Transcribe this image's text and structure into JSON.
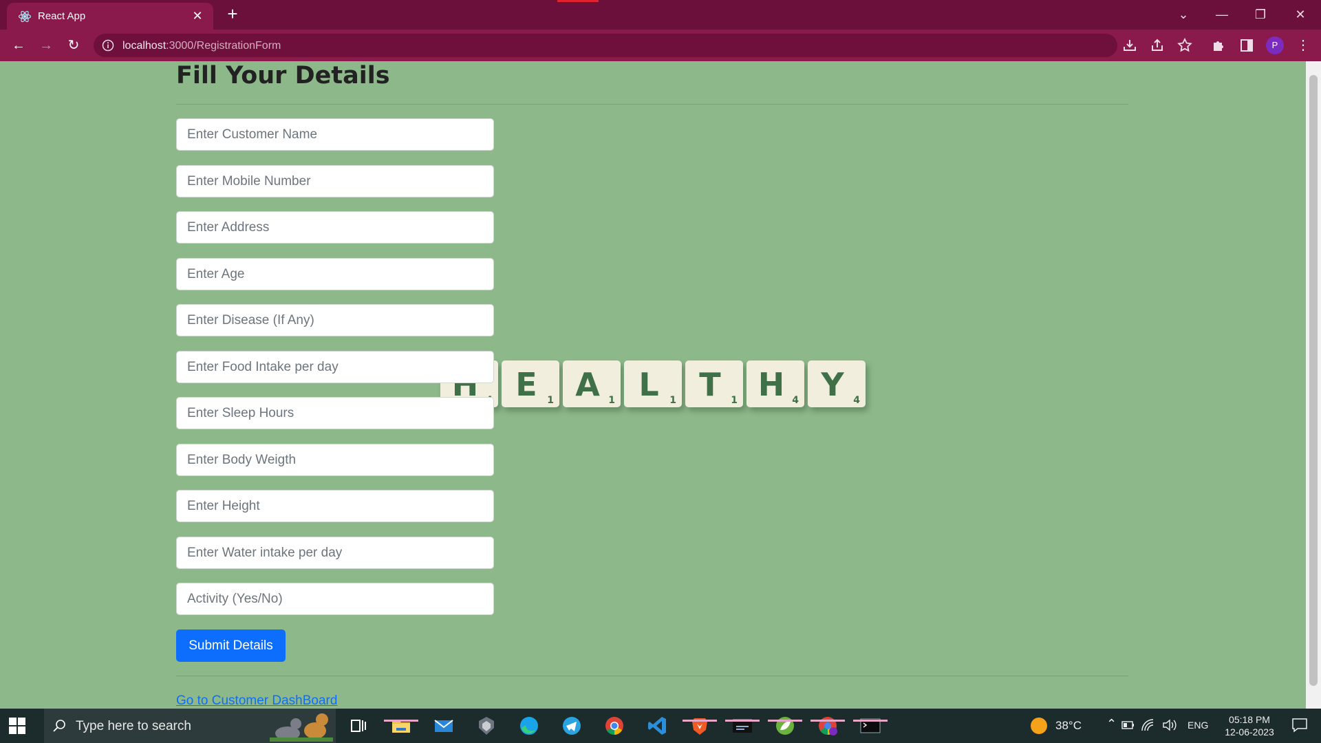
{
  "browser": {
    "tab_title": "React App",
    "url_host": "localhost",
    "url_rest": ":3000/RegistrationForm",
    "profile_initial": "P"
  },
  "page": {
    "heading": "Fill Your Details",
    "fields": {
      "customer_name": "Enter Customer Name",
      "mobile": "Enter Mobile Number",
      "address": "Enter Address",
      "age": "Enter Age",
      "disease": "Enter Disease (If Any)",
      "food": "Enter Food Intake per day",
      "sleep": "Enter Sleep Hours",
      "weight": "Enter Body Weigth",
      "height": "Enter Height",
      "water": "Enter Water intake per day",
      "activity": "Activity (Yes/No)"
    },
    "submit_label": "Submit Details",
    "dashboard_link": "Go to Customer DashBoard",
    "tiles": [
      {
        "letter": "H",
        "points": "4"
      },
      {
        "letter": "E",
        "points": "1"
      },
      {
        "letter": "A",
        "points": "1"
      },
      {
        "letter": "L",
        "points": "1"
      },
      {
        "letter": "T",
        "points": "1"
      },
      {
        "letter": "H",
        "points": "4"
      },
      {
        "letter": "Y",
        "points": "4"
      }
    ]
  },
  "taskbar": {
    "search_placeholder": "Type here to search",
    "temperature": "38°C",
    "language": "ENG",
    "time": "05:18 PM",
    "date": "12-06-2023",
    "apps": [
      "task-view",
      "file-explorer",
      "mail",
      "app-unknown",
      "edge",
      "telegram",
      "chrome",
      "vscode",
      "brave",
      "mysql",
      "spring",
      "chrome-profile",
      "terminal"
    ]
  },
  "colors": {
    "tabbar": "#6b0f3b",
    "toolbar": "#8a1a4c",
    "page_bg": "#8db88a",
    "primary": "#0d6efd",
    "tile_text": "#3f7048"
  }
}
